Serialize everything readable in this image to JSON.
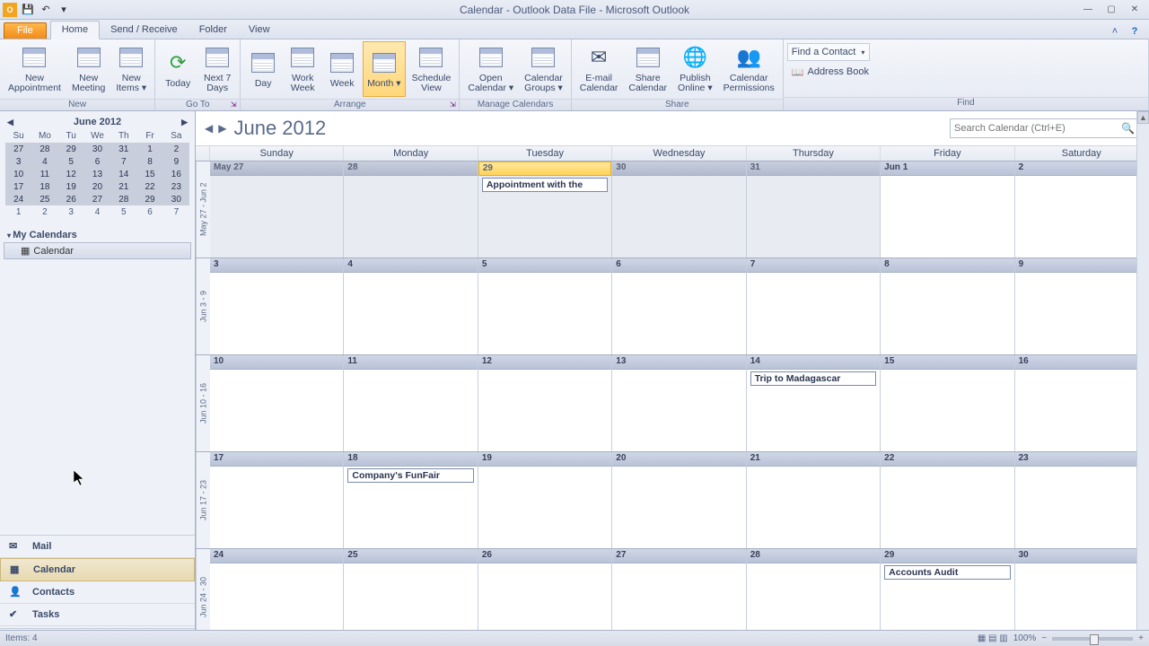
{
  "titlebar": {
    "title": "Calendar - Outlook Data File - Microsoft Outlook"
  },
  "tabs": {
    "file": "File",
    "items": [
      "Home",
      "Send / Receive",
      "Folder",
      "View"
    ],
    "activeIndex": 0
  },
  "ribbon": {
    "new": {
      "label": "New",
      "appointment": "New\nAppointment",
      "meeting": "New\nMeeting",
      "items": "New\nItems ▾"
    },
    "goto": {
      "label": "Go To",
      "today": "Today",
      "next7": "Next 7\nDays"
    },
    "arrange": {
      "label": "Arrange",
      "day": "Day",
      "workweek": "Work\nWeek",
      "week": "Week",
      "month": "Month ▾",
      "schedule": "Schedule\nView"
    },
    "manage": {
      "label": "Manage Calendars",
      "open": "Open\nCalendar ▾",
      "groups": "Calendar\nGroups ▾"
    },
    "share": {
      "label": "Share",
      "email": "E-mail\nCalendar",
      "sharecal": "Share\nCalendar",
      "publish": "Publish\nOnline ▾",
      "perm": "Calendar\nPermissions"
    },
    "find": {
      "label": "Find",
      "contact": "Find a Contact",
      "address": "Address Book"
    }
  },
  "minical": {
    "title": "June 2012",
    "dow": [
      "Su",
      "Mo",
      "Tu",
      "We",
      "Th",
      "Fr",
      "Sa"
    ],
    "nextrow": [
      "1",
      "2",
      "3",
      "4",
      "5",
      "6",
      "7"
    ]
  },
  "nav": {
    "mycals": "My Calendars",
    "calItem": "Calendar",
    "buttons": [
      "Mail",
      "Calendar",
      "Contacts",
      "Tasks"
    ],
    "activeButton": 1
  },
  "calendar": {
    "title": "June 2012",
    "searchPlaceholder": "Search Calendar (Ctrl+E)",
    "dow": [
      "Sunday",
      "Monday",
      "Tuesday",
      "Wednesday",
      "Thursday",
      "Friday",
      "Saturday"
    ],
    "weeks": [
      {
        "label": "May 27 - Jun 2",
        "days": [
          {
            "num": "May 27",
            "prev": true
          },
          {
            "num": "28",
            "prev": true
          },
          {
            "num": "29",
            "prev": true,
            "today": true,
            "appt": "Appointment with the"
          },
          {
            "num": "30",
            "prev": true
          },
          {
            "num": "31",
            "prev": true
          },
          {
            "num": "Jun 1"
          },
          {
            "num": "2"
          }
        ]
      },
      {
        "label": "Jun 3 - 9",
        "days": [
          {
            "num": "3"
          },
          {
            "num": "4"
          },
          {
            "num": "5"
          },
          {
            "num": "6"
          },
          {
            "num": "7"
          },
          {
            "num": "8"
          },
          {
            "num": "9"
          }
        ]
      },
      {
        "label": "Jun 10 - 16",
        "days": [
          {
            "num": "10"
          },
          {
            "num": "11"
          },
          {
            "num": "12"
          },
          {
            "num": "13"
          },
          {
            "num": "14",
            "appt": "Trip to Madagascar"
          },
          {
            "num": "15"
          },
          {
            "num": "16"
          }
        ]
      },
      {
        "label": "Jun 17 - 23",
        "days": [
          {
            "num": "17"
          },
          {
            "num": "18",
            "appt": "Company's FunFair"
          },
          {
            "num": "19"
          },
          {
            "num": "20"
          },
          {
            "num": "21"
          },
          {
            "num": "22"
          },
          {
            "num": "23"
          }
        ]
      },
      {
        "label": "Jun 24 - 30",
        "days": [
          {
            "num": "24"
          },
          {
            "num": "25"
          },
          {
            "num": "26"
          },
          {
            "num": "27"
          },
          {
            "num": "28"
          },
          {
            "num": "29",
            "appt": "Accounts Audit"
          },
          {
            "num": "30"
          }
        ]
      }
    ]
  },
  "status": {
    "left": "Items: 4",
    "zoom": "100%"
  }
}
